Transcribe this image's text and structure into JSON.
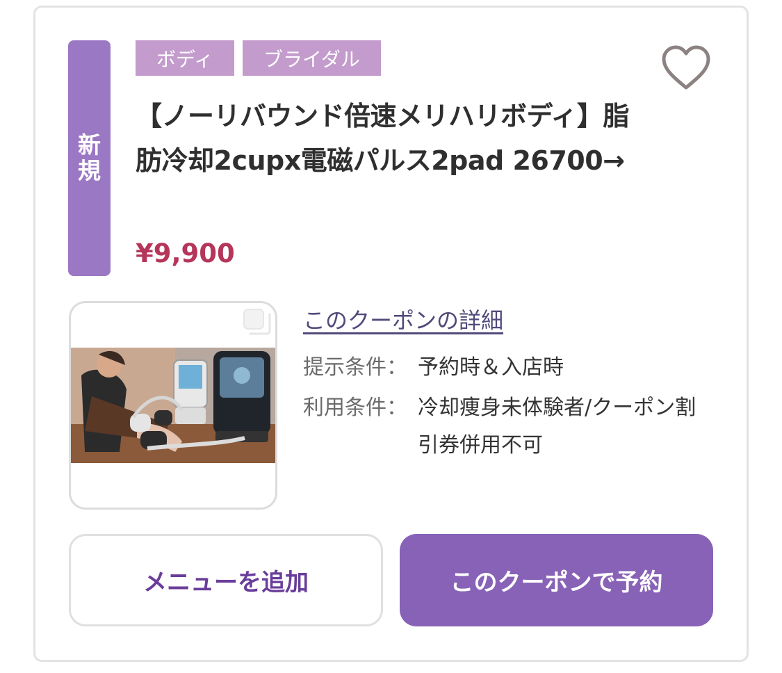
{
  "badge": {
    "line1": "新",
    "line2": "規"
  },
  "tags": [
    "ボディ",
    "ブライダル"
  ],
  "coupon": {
    "title": "【ノーリバウンド倍速メリハリボディ】脂肪冷却2cupx電磁パルス2pad 26700→",
    "price": "¥9,900"
  },
  "detail_link": "このクーポンの詳細",
  "conditions": [
    {
      "label": "提示条件：",
      "value": "予約時＆入店時"
    },
    {
      "label": "利用条件：",
      "value": "冷却痩身未体験者/クーポン割引券併用不可"
    }
  ],
  "buttons": {
    "add_menu": "メニューを追加",
    "reserve": "このクーポンで予約"
  },
  "colors": {
    "accent": "#8762b6",
    "tag": "#c39bcc",
    "price": "#b5365a",
    "link": "#504b7a"
  },
  "icons": {
    "favorite": "heart-icon",
    "gallery": "copy-icon"
  }
}
